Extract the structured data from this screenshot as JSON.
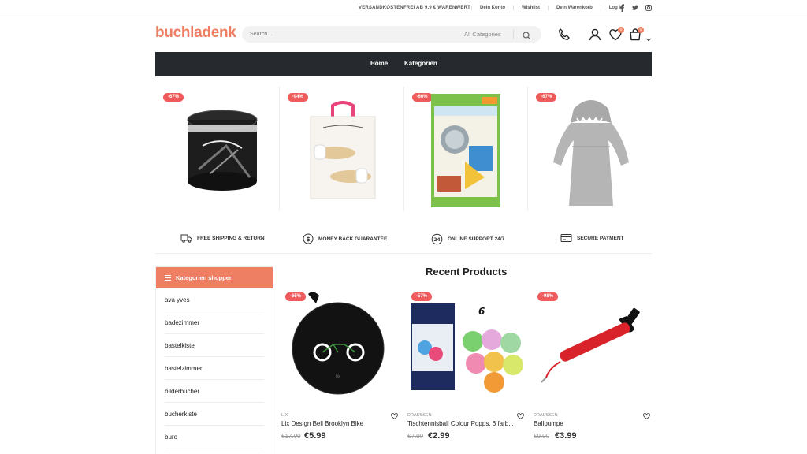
{
  "topbar": {
    "shipping_info": "VERSANDKOSTENFREI AB 9.9 € WARENWERT",
    "links": [
      "Dein Konto",
      "Wishlist",
      "Dein Warenkorb",
      "Log in"
    ],
    "social_icons": [
      "facebook-icon",
      "twitter-icon",
      "instagram-icon"
    ]
  },
  "header": {
    "logo": "buchladenk",
    "search_placeholder": "Search...",
    "category_select": "All Categories",
    "wishlist_count": "0",
    "cart_count": "0"
  },
  "nav": {
    "items": [
      "Home",
      "Kategorien"
    ]
  },
  "banner": {
    "discounts": [
      "-67%",
      "-94%",
      "-66%",
      "-67%"
    ]
  },
  "features": [
    {
      "icon": "truck-icon",
      "label": "FREE SHIPPING & RETURN"
    },
    {
      "icon": "dollar-icon",
      "label": "MONEY BACK GUARANTEE"
    },
    {
      "icon": "support-24-icon",
      "label": "ONLINE SUPPORT 24/7"
    },
    {
      "icon": "credit-card-icon",
      "label": "SECURE PAYMENT"
    }
  ],
  "sidebar": {
    "title": "Kategorien shoppen",
    "items": [
      "ava yves",
      "badezimmer",
      "bastelkiste",
      "bastelzimmer",
      "bilderbucher",
      "bucherkiste",
      "buro"
    ]
  },
  "recent": {
    "title": "Recent Products",
    "products": [
      {
        "discount": "-65%",
        "category": "LIX",
        "name": "Lix Design Bell Brooklyn Bike",
        "old_price": "€17.00",
        "price": "€5.99"
      },
      {
        "discount": "-57%",
        "category": "DRAUSSEN",
        "name": "Tischtennisball Colour Popps, 6 farb...",
        "old_price": "€7.00",
        "price": "€2.99"
      },
      {
        "discount": "-98%",
        "category": "DRAUSSEN",
        "name": "Ballpumpe",
        "old_price": "€9.00",
        "price": "€3.99"
      }
    ]
  },
  "colors": {
    "accent": "#ef7f62",
    "discount": "#ef5b5b",
    "nav_bg": "#262a2e"
  }
}
